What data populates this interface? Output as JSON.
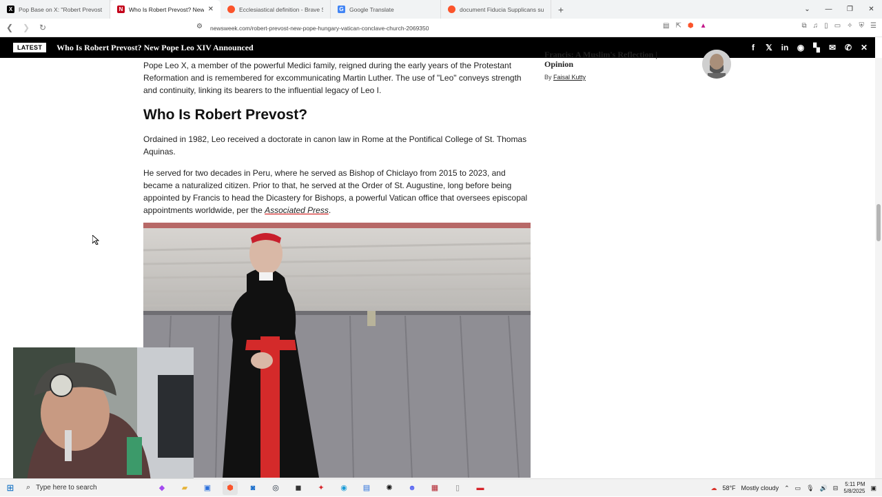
{
  "browser": {
    "tabs": [
      {
        "title": "Pop Base on X: \"Robert Prevost be",
        "icon": "x-logo-icon",
        "active": false
      },
      {
        "title": "Who Is Robert Prevost? New P",
        "icon": "newsweek-icon",
        "active": true
      },
      {
        "title": "Ecclesiastical definition - Brave Sear",
        "icon": "brave-icon",
        "active": false
      },
      {
        "title": "Google Translate",
        "icon": "google-translate-icon",
        "active": false
      },
      {
        "title": "document Fiducia Supplicans summ",
        "icon": "brave-icon",
        "active": false
      }
    ],
    "url": "newsweek.com/robert-prevost-new-pope-hungary-vatican-conclave-church-2069350"
  },
  "latest_bar": {
    "badge": "LATEST",
    "title": "Who Is Robert Prevost? New Pope Leo XIV Announced"
  },
  "article": {
    "para1": "Pope Leo X, a member of the powerful Medici family, reigned during the early years of the Protestant Reformation and is remembered for excommunicating Martin Luther. The use of \"Leo\" conveys strength and continuity, linking its bearers to the influential legacy of Leo I.",
    "heading": "Who Is Robert Prevost?",
    "para2": "Ordained in 1982, Leo received a doctorate in canon law in Rome at the Pontifical College of St. Thomas Aquinas.",
    "para3_prefix": "He served for two decades in Peru, where he served as Bishop of Chiclayo from 2015 to 2023, and became a naturalized citizen. Prior to that, he served at the Order of St. Augustine, long before being appointed by Francis to head the Dicastery for Bishops, a powerful Vatican office that oversees episcopal appointments worldwide, per the ",
    "para3_link": "Associated Press",
    "para3_suffix": "."
  },
  "sidebar": {
    "title_partial": "Francis: A Muslim's Reflection | Opinion",
    "by_label": "By",
    "author": "Faisal Kutty"
  },
  "taskbar": {
    "search_placeholder": "Type here to search",
    "weather_temp": "58°F",
    "weather_text": "Mostly cloudy",
    "time": "5:11 PM",
    "date": "5/8/2025"
  }
}
